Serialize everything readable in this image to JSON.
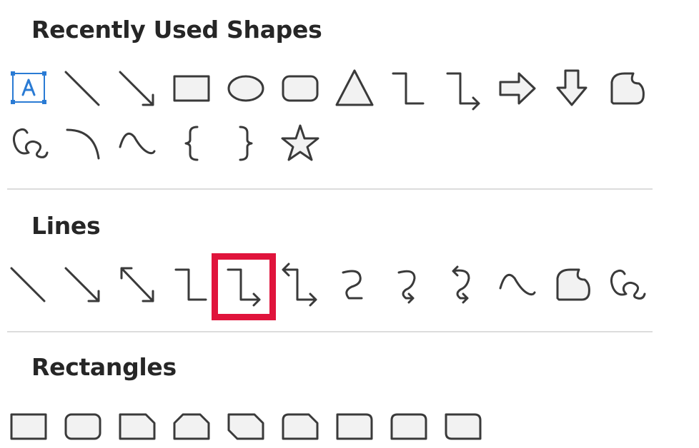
{
  "sections": {
    "recent": {
      "title": "Recently Used Shapes",
      "items": [
        "Text Box",
        "Line",
        "Arrow",
        "Rectangle",
        "Oval",
        "Rounded Rectangle",
        "Triangle",
        "Elbow Connector",
        "Elbow Arrow Connector",
        "Right Arrow",
        "Down Arrow",
        "Freeform Shape",
        "Freeform Scribble",
        "Arc",
        "Curve",
        "Left Brace",
        "Right Brace",
        "Star"
      ]
    },
    "lines": {
      "title": "Lines",
      "items": [
        "Line",
        "Arrow",
        "Double Arrow",
        "Elbow Connector",
        "Elbow Arrow Connector",
        "Elbow Double-Arrow Connector",
        "Curved Connector",
        "Curved Arrow Connector",
        "Curved Double-Arrow Connector",
        "Curve",
        "Freeform Shape",
        "Freeform Scribble"
      ],
      "selected_item": "Elbow Arrow Connector"
    },
    "rectangles": {
      "title": "Rectangles",
      "items": [
        "Rectangle",
        "Rounded Rectangle",
        "Single Corner Snipped",
        "Snip Same Side Corner",
        "Snip Diagonal Corner",
        "Snip and Round Single Corner",
        "Round Single Corner",
        "Round Same Side Corner",
        "Round Diagonal Corner"
      ]
    }
  },
  "colors": {
    "highlight": "#e0143c",
    "textbox_accent": "#2a7bd4"
  }
}
